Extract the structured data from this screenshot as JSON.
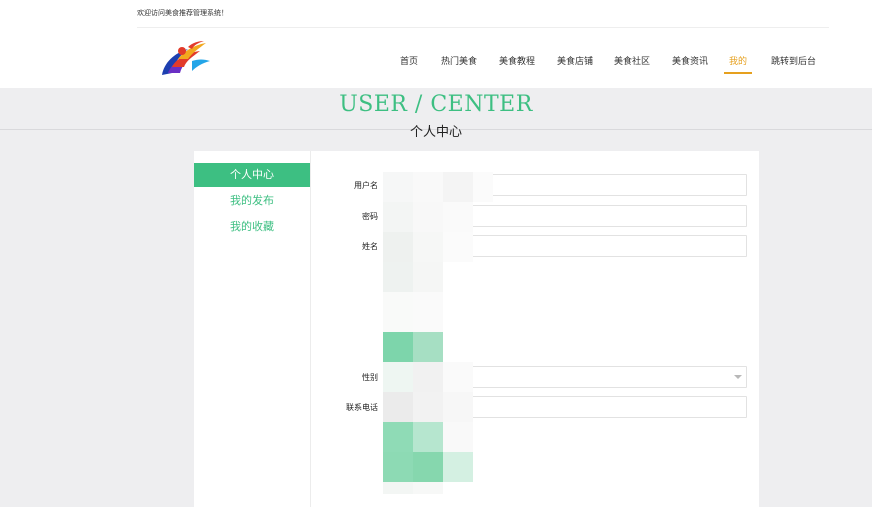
{
  "header": {
    "welcome_text": "欢迎访问美食推荐管理系统！"
  },
  "nav": {
    "items": [
      {
        "label": "首页",
        "active": false
      },
      {
        "label": "热门美食",
        "active": false
      },
      {
        "label": "美食教程",
        "active": false
      },
      {
        "label": "美食店铺",
        "active": false
      },
      {
        "label": "美食社区",
        "active": false
      },
      {
        "label": "美食资讯",
        "active": false
      },
      {
        "label": "我的",
        "active": true
      },
      {
        "label": "跳转到后台",
        "active": false
      }
    ]
  },
  "banner": {
    "title_en": "USER / CENTER",
    "title_cn": "个人中心"
  },
  "sidebar": {
    "items": [
      {
        "label": "个人中心",
        "active": true
      },
      {
        "label": "我的发布",
        "active": false
      },
      {
        "label": "我的收藏",
        "active": false
      }
    ]
  },
  "form": {
    "username_label": "用户名",
    "username_value": "",
    "password_label": "密码",
    "password_value": "",
    "name_label": "姓名",
    "name_value": "",
    "gender_label": "性别",
    "gender_value": "",
    "phone_label": "联系电话",
    "phone_value": ""
  },
  "colors": {
    "accent": "#3dbf82",
    "nav_active": "#e6a01e",
    "background": "#eeeef0"
  }
}
